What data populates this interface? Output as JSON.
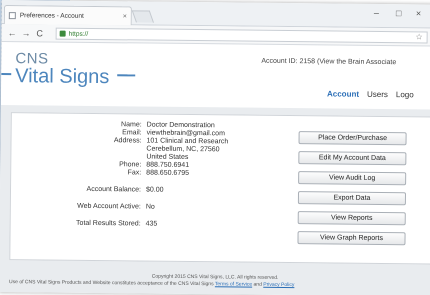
{
  "browser": {
    "tab_title": "Preferences - Account",
    "tab_close": "×",
    "url": "https://",
    "controls": {
      "minimize": "–",
      "maximize": "□",
      "close": "×"
    },
    "nav": {
      "back": "←",
      "forward": "→",
      "reload": "C"
    },
    "bookmark_icon": "☆"
  },
  "header": {
    "logo_top": "CNS",
    "logo_bottom": "Vital Signs",
    "account_id": "Account ID: 2158 (View the Brain Associate",
    "menu": [
      {
        "label": "Account",
        "active": true
      },
      {
        "label": "Users",
        "active": false
      },
      {
        "label": "Logo",
        "active": false
      }
    ]
  },
  "account": {
    "name_label": "Name:",
    "name": "Doctor Demonstration",
    "email_label": "Email:",
    "email": "viewthebrain@gmail.com",
    "address_label": "Address:",
    "address_lines": [
      "101 Clinical and Research",
      "Cerebellum, NC, 27560",
      "United States"
    ],
    "phone_label": "Phone:",
    "phone": "888.750.6941",
    "fax_label": "Fax:",
    "fax": "888.650.6795",
    "balance_label": "Account Balance:",
    "balance": "$0.00",
    "web_active_label": "Web Account Active:",
    "web_active": "No",
    "total_label": "Total Results Stored:",
    "total": "435"
  },
  "actions": {
    "place_order": "Place Order/Purchase",
    "edit_account": "Edit My Account Data",
    "audit_log": "View Audit Log",
    "export": "Export Data",
    "reports": "View Reports",
    "graph_reports": "View Graph Reports"
  },
  "footer": {
    "copyright": "Copyright 2015 CNS Vital Signs, LLC. All rights reserved.",
    "notice": "Use of CNS Vital Signs Products and Website constitutes acceptance of the CNS Vital Signs",
    "terms_link": "Terms of Service",
    "and": "and",
    "privacy_link": "Privacy Policy"
  }
}
